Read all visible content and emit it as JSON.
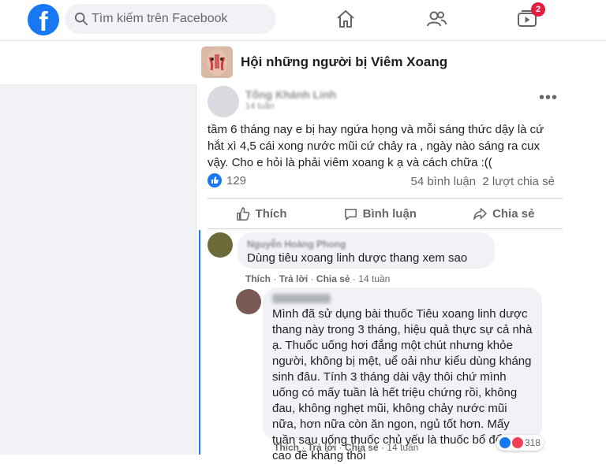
{
  "topbar": {
    "logo_letter": "f",
    "search_placeholder": "Tìm kiếm trên Facebook",
    "icons": [
      "home-icon",
      "friends-icon",
      "watch-icon"
    ],
    "watch_badge": "2",
    "brand_color": "#1877f2"
  },
  "group": {
    "name": "Hội những người bị Viêm Xoang"
  },
  "post": {
    "author": "Tống Khánh Linh",
    "time": "14 tuần",
    "text": "tầm 6 tháng nay e bị hay ngứa họng và mỗi sáng thức dậy là cứ hắt xì 4,5 cái xong nước mũi cứ chảy ra , ngày nào sáng ra cux vậy. Cho e hỏi là phải viêm xoang k ạ và cách chữa :((",
    "reactions_count": "129",
    "comments_count": "54 bình luận",
    "shares_count": "2 lượt chia sẻ",
    "actions": {
      "like": "Thích",
      "comment": "Bình luận",
      "share": "Chia sẻ"
    }
  },
  "comments": [
    {
      "author": "Nguyễn Hoàng Phong",
      "text": "Dùng tiêu xoang linh dược thang xem sao",
      "meta": {
        "like": "Thích",
        "reply": "Trả lời",
        "share": "Chia sẻ",
        "time": "14 tuần"
      }
    },
    {
      "text": "Mình đã sử dụng bài thuốc Tiêu xoang linh dược thang này trong 3 tháng, hiệu quả thực sự cả nhà ạ. Thuốc uống hơi đắng một chút nhưng khỏe người, không bị mệt, uể oải như kiểu dùng kháng sinh đâu. Tính 3 tháng dài vậy thôi chứ mình uống có mấy tuần là hết triệu chứng rồi, không đau, không nghẹt mũi, không chảy nước mũi nữa, hơn nữa còn ăn ngon, ngủ tốt hơn. Mấy tuần sau uống thuốc chủ yếu là thuốc bổ để nâng cao đề kháng thôi",
      "reactions_count": "318",
      "meta": {
        "like": "Thích",
        "reply": "Trả lời",
        "share": "Chia sẻ",
        "time": "14 tuần"
      }
    }
  ],
  "meta_separator": "·"
}
